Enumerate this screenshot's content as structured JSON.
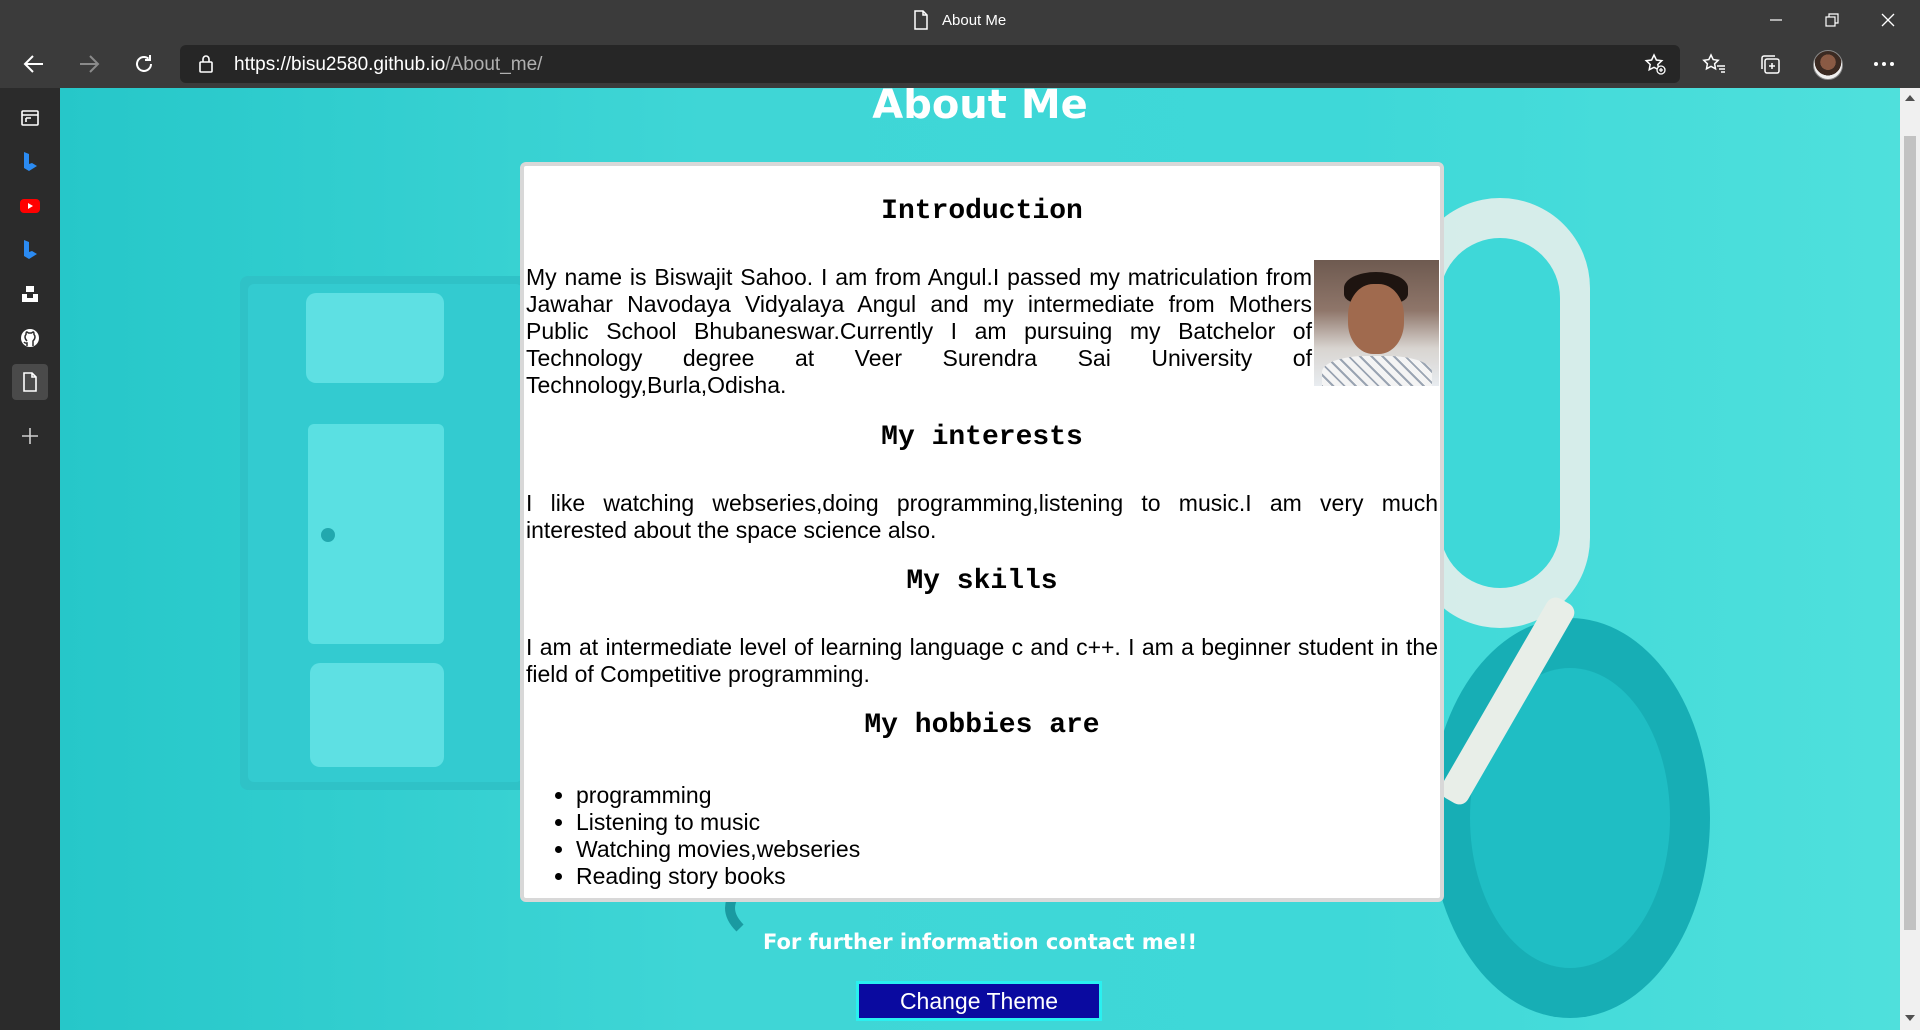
{
  "window": {
    "title": "About Me"
  },
  "toolbar": {
    "url_host": "https://bisu2580.github.io",
    "url_path": "/About_me/"
  },
  "icons": {
    "back": "arrow-left-icon",
    "forward": "arrow-right-icon",
    "refresh": "refresh-icon",
    "lock": "lock-icon",
    "favorite": "star-plus-icon",
    "favorites": "favorites-icon",
    "collections": "collections-icon",
    "menu": "more-icon"
  },
  "sidebar": {
    "items": [
      "tabs-icon",
      "bing-icon",
      "youtube-icon",
      "bing-icon",
      "unsplash-icon",
      "github-icon",
      "document-icon",
      "add-icon"
    ]
  },
  "page": {
    "title": "About Me",
    "intro_heading": "Introduction",
    "intro_text": "My name is Biswajit Sahoo. I am from Angul.I passed my matriculation from Jawahar Navodaya Vidyalaya Angul and my intermediate from Mothers Public School Bhubaneswar.Currently I am pursuing my Batchelor of Technology degree at Veer Surendra Sai University of Technology,Burla,Odisha.",
    "interests_heading": "My interests",
    "interests_text": "I like watching webseries,doing programming,listening to music.I am very much interested about the space science also.",
    "skills_heading": "My skills",
    "skills_text": "I am at intermediate level of learning language c and c++. I am a beginner student in the field of Competitive programming.",
    "hobbies_heading": "My hobbies are",
    "hobbies": [
      "programming",
      "Listening to music",
      "Watching movies,webseries",
      "Reading story books"
    ],
    "contact_text": "For further information contact me!!",
    "theme_button": "Change Theme"
  },
  "colors": {
    "background": "#3ed8d8",
    "button": "#0a0aa0",
    "button_border": "#2af0f0",
    "chrome": "#3b3b3b"
  }
}
